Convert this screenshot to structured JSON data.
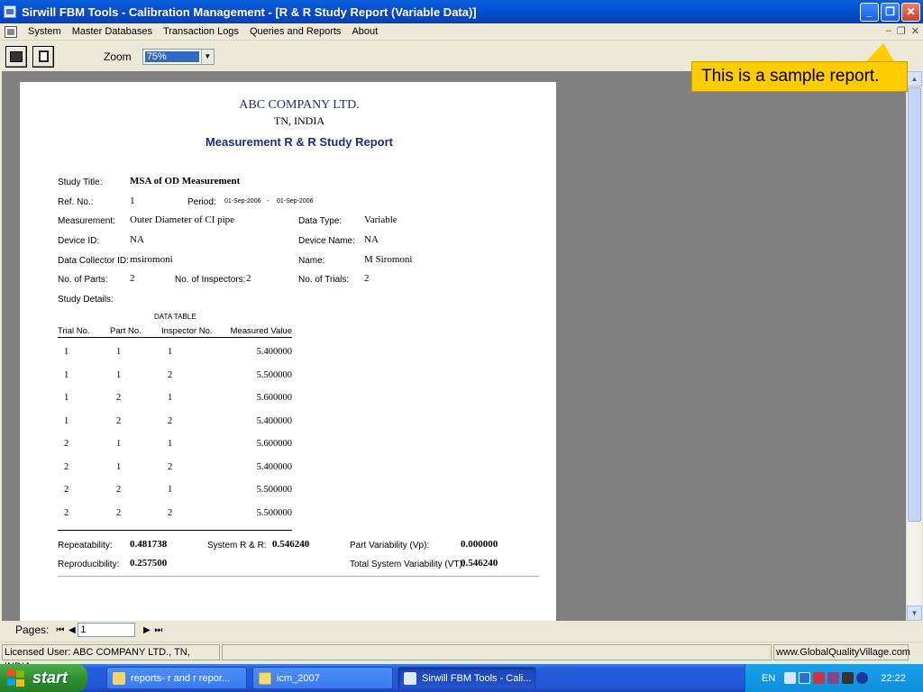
{
  "window": {
    "title": "Sirwill FBM Tools - Calibration Management - [R & R Study Report (Variable Data)]",
    "minimize_glyph": "_",
    "maximize_glyph": "❐",
    "close_glyph": "✕"
  },
  "menu": {
    "items": [
      "System",
      "Master Databases",
      "Transaction Logs",
      "Queries and Reports",
      "About"
    ],
    "mdi_controls": [
      "–",
      "❐",
      "✕"
    ]
  },
  "toolbar": {
    "buttons": [
      "printer-icon",
      "export-icon"
    ],
    "zoom_label": "Zoom",
    "zoom_value": "75%"
  },
  "callout": {
    "text": "This is a sample report.",
    "color": "#ffcc00"
  },
  "report": {
    "company": "ABC COMPANY LTD.",
    "location": "TN, INDIA",
    "title": "Measurement R & R Study Report",
    "fields": {
      "study_title_label": "Study Title:",
      "study_title": "MSA of OD Measurement",
      "ref_no_label": "Ref. No.:",
      "ref_no": "1",
      "period_label": "Period:",
      "period_from": "01-Sep-2006",
      "period_sep": "-",
      "period_to": "01-Sep-2006",
      "measurement_label": "Measurement:",
      "measurement": "Outer Diameter of CI pipe",
      "data_type_label": "Data Type:",
      "data_type": "Variable",
      "device_id_label": "Device ID:",
      "device_id": "NA",
      "device_name_label": "Device Name:",
      "device_name": "NA",
      "collector_id_label": "Data Collector ID:",
      "collector_id": "msiromoni",
      "name_label": "Name:",
      "name": "M Siromoni",
      "parts_label": "No. of Parts:",
      "parts": "2",
      "inspectors_label": "No. of Inspectors:",
      "inspectors": "2",
      "trials_label": "No. of Trials:",
      "trials": "2",
      "details_label": "Study Details:"
    },
    "table": {
      "caption": "DATA TABLE",
      "headers": [
        "Trial No.",
        "Part No.",
        "Inspector No.",
        "Measured Value"
      ],
      "rows": [
        [
          "1",
          "1",
          "1",
          "5.400000"
        ],
        [
          "1",
          "1",
          "2",
          "5.500000"
        ],
        [
          "1",
          "2",
          "1",
          "5.600000"
        ],
        [
          "1",
          "2",
          "2",
          "5.400000"
        ],
        [
          "2",
          "1",
          "1",
          "5.600000"
        ],
        [
          "2",
          "1",
          "2",
          "5.400000"
        ],
        [
          "2",
          "2",
          "1",
          "5.500000"
        ],
        [
          "2",
          "2",
          "2",
          "5.500000"
        ]
      ]
    },
    "summary": {
      "repeatability_label": "Repeatability:",
      "repeatability": "0.481738",
      "system_rr_label": "System R & R:",
      "system_rr": "0.546240",
      "part_var_label": "Part Variability (Vp):",
      "part_var": "0.000000",
      "reproducibility_label": "Reproducibility:",
      "reproducibility": "0.257500",
      "total_var_label": "Total System Variability (VT):",
      "total_var": "0.546240"
    }
  },
  "pages": {
    "label": "Pages:",
    "current": "1"
  },
  "status": {
    "licensed_user": "Licensed User: ABC COMPANY LTD., TN, INDIA",
    "website": "www.GlobalQualityVillage.com"
  },
  "taskbar": {
    "start_label": "start",
    "tasks": [
      "reports- r and r repor...",
      "icm_2007",
      "Sirwill FBM Tools - Cali..."
    ],
    "language": "EN",
    "clock": "22:22"
  }
}
